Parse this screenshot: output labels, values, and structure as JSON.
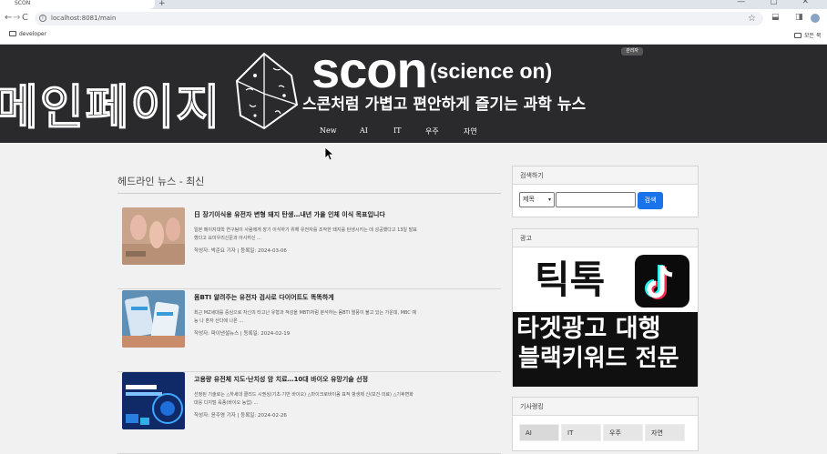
{
  "browser": {
    "tab_title": "SCON",
    "tab_add": "+",
    "window_controls": "— ▢ ✕",
    "nav_back": "←",
    "nav_forward": "→",
    "nav_reload": "C",
    "url_info": "i",
    "url": "localhost:8081/main",
    "star": "☆",
    "extensions": "⬓",
    "sidepanel": "◨",
    "bookmarks": [
      {
        "label": "developer"
      }
    ],
    "bookmarks_right": "모든 북"
  },
  "hero": {
    "page_label": "메인페이지",
    "brand": "scon",
    "brand_sub": "(science on)",
    "slogan": "스콘처럼 가볍고 편안하게 즐기는 과학 뉴스",
    "admin_badge": "관리자",
    "menu": [
      "New",
      "AI",
      "IT",
      "우주",
      "자연"
    ]
  },
  "main": {
    "heading": "헤드라인 뉴스 - 최신",
    "news": [
      {
        "title": "日 장기이식용 유전자 변형 돼지 탄생…내년 가을 인체 이식 목표입니다",
        "desc": "일본 메이지대학 연구팀이 사람에게 장기 이식하기 위해 유전자를 조작한 돼지를 탄생시키는 데 성공했다고 13일 발표했다고 요미우리신문과 아사히신 ...",
        "meta": "작성자: 박준요 기자 | 등록일: 2024-03-06"
      },
      {
        "title": "몸BTI 알려주는 유전자 검사로 다이어트도 똑똑하게",
        "desc": "최근 MZ세대를 중심으로 자신의 타고난 유형과 적성을 MBTI처럼 분석하는 몸BTI 열풍이 불고 있는 가운데, MBC 예능 나 혼자 산다에 나온 ...",
        "meta": "작성자: 파이낸셜뉴스 | 등록일: 2024-02-19"
      },
      {
        "title": "고용량 유전체 지도·난치성 암 치료…10대 바이오 유망기술 선정",
        "desc": "선정된 기술로는 △하세대 클리드 시퀀싱(기초·기반 바이오) △마이크로바이옴 표적 항생제 신(보건·의료) △기후변화 대응 디지털 육종(바이오 농업) ...",
        "meta": "작성자: 윤주영 기자 | 등록일: 2024-02-26"
      }
    ]
  },
  "sidebar": {
    "search": {
      "header": "검색하기",
      "select_value": "제목",
      "button": "검색"
    },
    "ad": {
      "header": "광고",
      "line_top": "틱톡",
      "line1": "타겟광고 대행",
      "line2": "블랙키워드 전문"
    },
    "ranking": {
      "header": "기사랭킹",
      "tabs": [
        "AI",
        "IT",
        "우주",
        "자연"
      ]
    }
  },
  "colors": {
    "hero_bg": "#2a2a2c",
    "search_button": "#1a73e8",
    "page_bg": "#f1f1f1"
  }
}
